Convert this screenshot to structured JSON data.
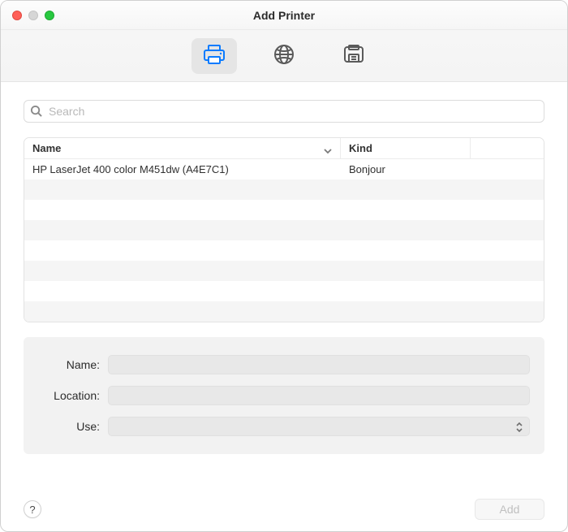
{
  "window": {
    "title": "Add Printer"
  },
  "tabs": {
    "default_name": "default-tab",
    "ip_name": "ip-tab",
    "advanced_name": "advanced-tab"
  },
  "search": {
    "placeholder": "Search",
    "value": ""
  },
  "table": {
    "headers": {
      "name": "Name",
      "kind": "Kind"
    },
    "rows": [
      {
        "name": "HP LaserJet 400 color M451dw (A4E7C1)",
        "kind": "Bonjour"
      }
    ]
  },
  "form": {
    "labels": {
      "name": "Name:",
      "location": "Location:",
      "use": "Use:"
    },
    "values": {
      "name": "",
      "location": "",
      "use": ""
    }
  },
  "footer": {
    "help": "?",
    "add": "Add"
  }
}
